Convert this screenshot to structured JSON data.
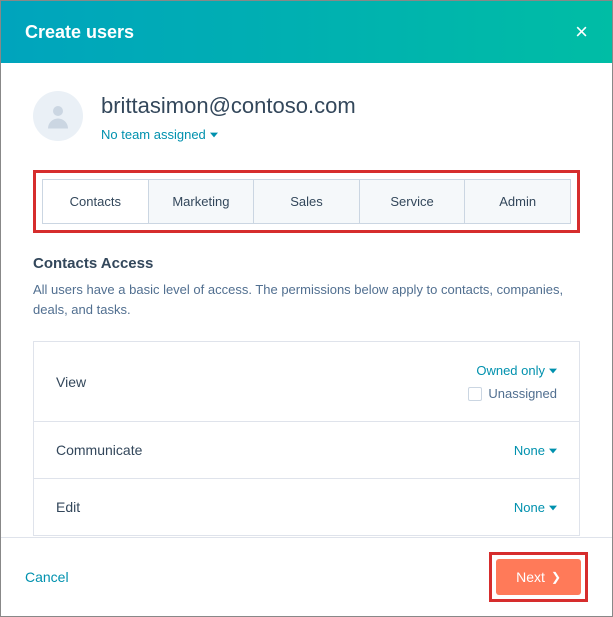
{
  "header": {
    "title": "Create users"
  },
  "user": {
    "email": "brittasimon@contoso.com",
    "team_label": "No team assigned"
  },
  "tabs": {
    "0": "Contacts",
    "1": "Marketing",
    "2": "Sales",
    "3": "Service",
    "4": "Admin"
  },
  "section": {
    "title": "Contacts Access",
    "description": "All users have a basic level of access. The permissions below apply to contacts, companies, deals, and tasks."
  },
  "permissions": {
    "view": {
      "label": "View",
      "value": "Owned only",
      "unassigned_label": "Unassigned"
    },
    "communicate": {
      "label": "Communicate",
      "value": "None"
    },
    "edit": {
      "label": "Edit",
      "value": "None"
    }
  },
  "footer": {
    "cancel": "Cancel",
    "next": "Next"
  }
}
